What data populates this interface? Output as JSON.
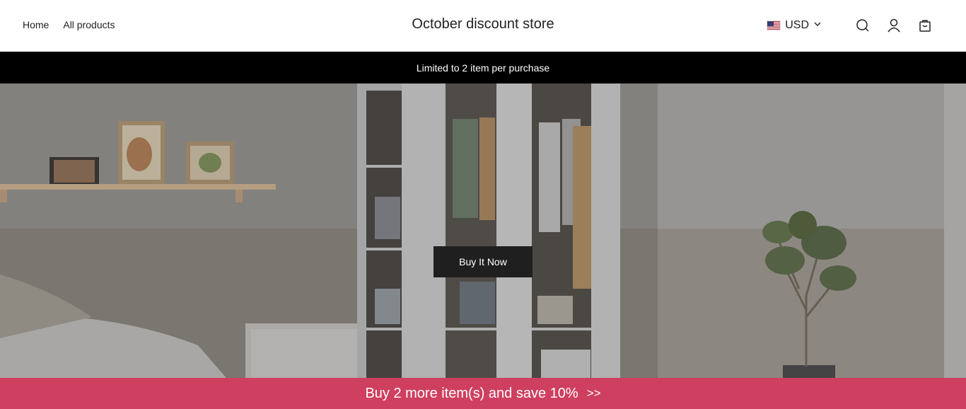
{
  "nav": {
    "home": "Home",
    "all_products": "All products"
  },
  "store": {
    "title": "October discount store"
  },
  "currency": {
    "code": "USD",
    "flag": "us-flag-icon"
  },
  "icons": {
    "search": "search-icon",
    "account": "user-icon",
    "cart": "cart-icon"
  },
  "announcement": {
    "text": "Limited to 2 item per purchase"
  },
  "hero": {
    "button_label": "Buy It Now"
  },
  "promo": {
    "text": "Buy 2 more item(s) and save 10%",
    "arrows": ">>"
  },
  "colors": {
    "announce_bg": "#000000",
    "promo_bg": "#cf3f60",
    "button_bg": "#1f1f1f"
  }
}
